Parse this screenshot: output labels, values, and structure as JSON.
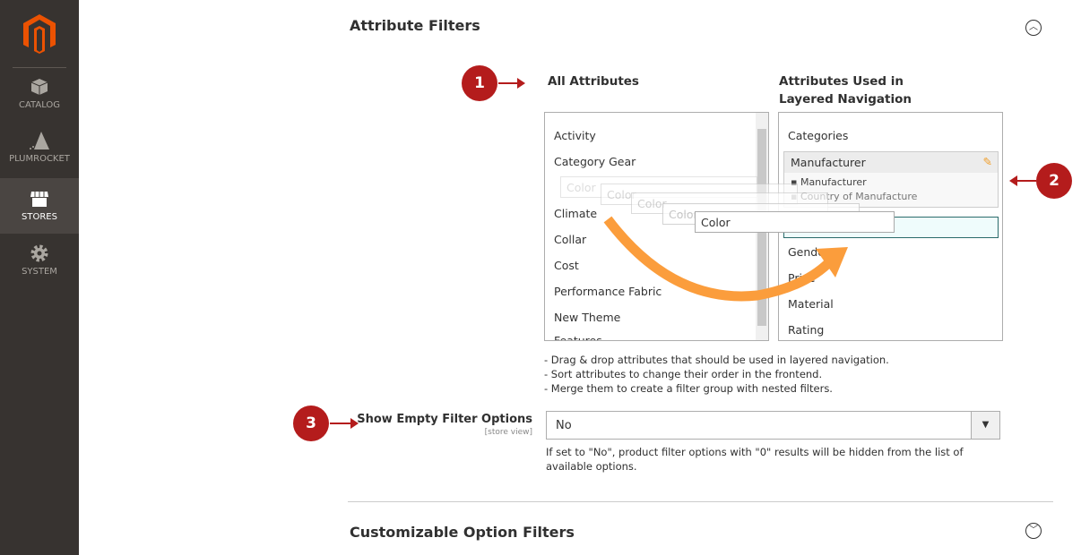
{
  "sidebar": {
    "items": [
      {
        "label": "CATALOG",
        "icon": "box-icon"
      },
      {
        "label": "PLUMROCKET",
        "icon": "pyramid-icon"
      },
      {
        "label": "STORES",
        "icon": "store-icon",
        "active": true
      },
      {
        "label": "SYSTEM",
        "icon": "gear-icon"
      }
    ]
  },
  "sections": {
    "attribute_filters": "Attribute Filters",
    "customizable_filters": "Customizable Option Filters"
  },
  "badges": [
    "1",
    "2",
    "3"
  ],
  "all_attributes": {
    "title": "All Attributes",
    "items": [
      "Activity",
      "Category Gear",
      "Climate",
      "Collar",
      "Cost",
      "Performance Fabric",
      "New Theme",
      "Features"
    ]
  },
  "layered": {
    "title": "Attributes Used in Layered Navigation",
    "categories": "Categories",
    "group": {
      "label": "Manufacturer",
      "children": [
        "Manufacturer",
        "Country of Manufacture"
      ]
    },
    "items": [
      "Gender",
      "Price",
      "Material",
      "Rating"
    ]
  },
  "drag_item": "Color",
  "notes": [
    "- Drag & drop attributes that should be used in layered navigation.",
    "- Sort attributes to change their order in the frontend.",
    "- Merge them to create a filter group with nested filters."
  ],
  "empty_options": {
    "label": "Show Empty Filter Options",
    "scope": "[store view]",
    "value": "No",
    "hint": "If set to \"No\", product filter options with \"0\" results will be hidden from the list of available options."
  },
  "colors": {
    "accent": "#b41c1c",
    "sidebar": "#373330",
    "drag_arrow": "#fb9d3c",
    "logo": "#eb5202"
  }
}
